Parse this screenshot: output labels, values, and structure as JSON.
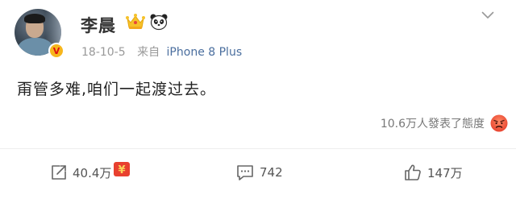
{
  "post": {
    "username": "李晨",
    "date": "18-10-5",
    "from_label": "来自",
    "device": "iPhone 8 Plus",
    "content": "甭管多难,咱们一起渡过去。",
    "reactions_text": "10.6万人發表了態度"
  },
  "actions": {
    "share_count": "40.4万",
    "comment_count": "742",
    "like_count": "147万"
  },
  "badge": {
    "verified_letter": "V"
  },
  "colors": {
    "link_blue": "#4a6e9e",
    "meta_gray": "#999999",
    "badge_gold": "#f7b61c",
    "angry_red": "#e8543f"
  },
  "icons": [
    "crown-icon",
    "panda-icon",
    "chevron-down-icon",
    "share-icon",
    "comment-icon",
    "like-icon",
    "angry-emoji-icon",
    "red-packet-icon",
    "verified-icon"
  ]
}
